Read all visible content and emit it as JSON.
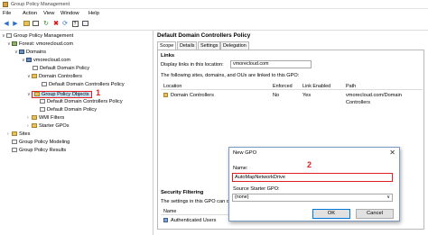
{
  "window": {
    "title": "Group Policy Management"
  },
  "menu": [
    "File",
    "Action",
    "View",
    "Window",
    "Help"
  ],
  "tree": {
    "root": "Group Policy Management",
    "forest": "Forest: vmorecloud.com",
    "domains": "Domains",
    "domain": "vmorecloud.com",
    "default_domain_policy": "Default Domain Policy",
    "domain_controllers": "Domain Controllers",
    "default_dc_policy": "Default Domain Controllers Policy",
    "gpo_folder": "Group Policy Objects",
    "gpo_dc_policy": "Default Domain Controllers Policy",
    "gpo_domain_policy": "Default Domain Policy",
    "wmi_filters": "WMI Filters",
    "starter_gpos": "Starter GPOs",
    "sites": "Sites",
    "modeling": "Group Policy Modeling",
    "results": "Group Policy Results",
    "annotation": "1"
  },
  "details": {
    "title": "Default Domain Controllers Policy",
    "tabs": [
      "Scope",
      "Details",
      "Settings",
      "Delegation"
    ],
    "links_heading": "Links",
    "display_links_label": "Display links in this location:",
    "display_links_value": "vmorecloud.com",
    "linked_text": "The following sites, domains, and OUs are linked to this GPO:",
    "columns": [
      "Location",
      "Enforced",
      "Link Enabled",
      "Path"
    ],
    "rows": [
      {
        "location": "Domain Controllers",
        "enforced": "No",
        "link_enabled": "Yes",
        "path": "vmorecloud.com/Domain Controllers"
      }
    ],
    "security_heading": "Security Filtering",
    "security_text": "The settings in this GPO can onl",
    "security_col": "Name",
    "security_row": "Authenticated Users"
  },
  "dialog": {
    "title": "New GPO",
    "name_label": "Name:",
    "name_value": "AutoMapNetworkDrive",
    "starter_label": "Source Starter GPO:",
    "starter_value": "(none)",
    "ok": "OK",
    "cancel": "Cancel",
    "annotation": "2"
  }
}
